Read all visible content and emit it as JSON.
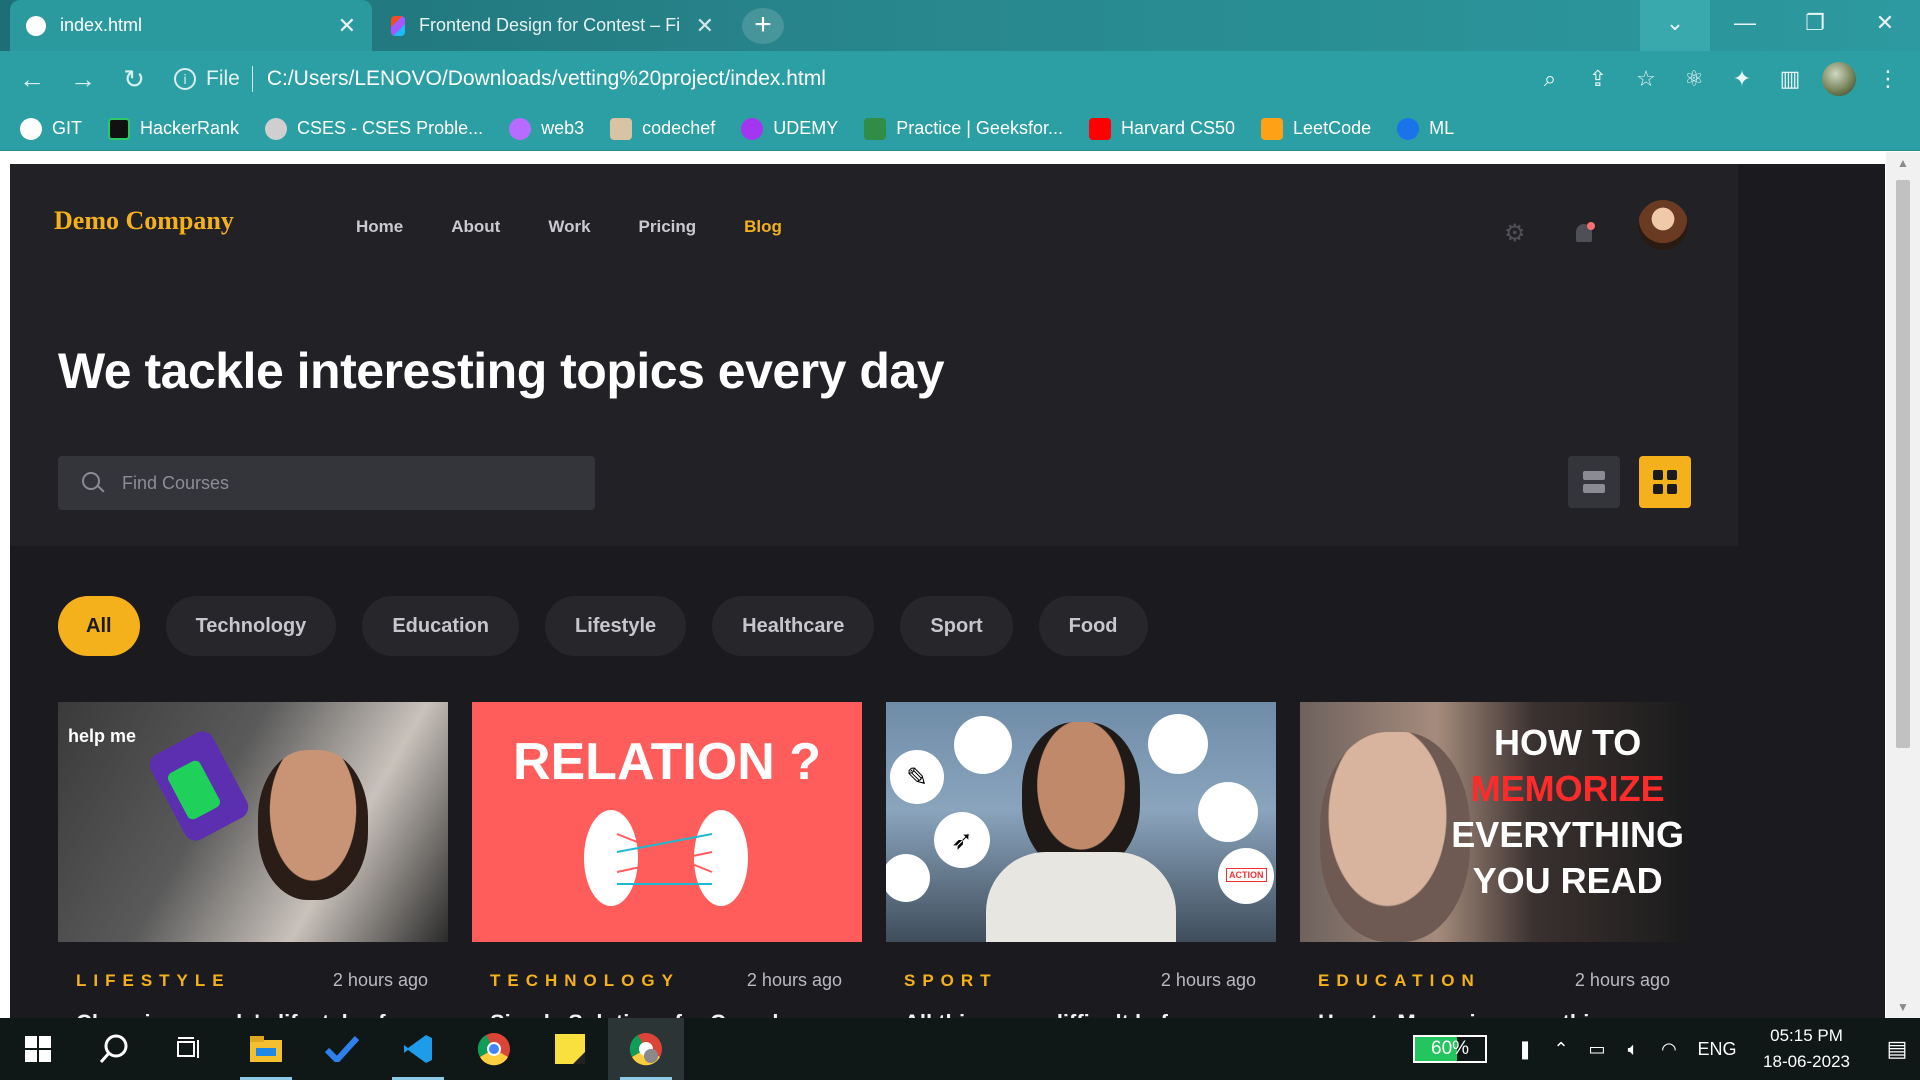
{
  "browser": {
    "tabs": [
      {
        "title": "index.html",
        "close": "✕"
      },
      {
        "title": "Frontend Design for Contest – Fi",
        "close": "✕"
      }
    ],
    "new_tab": "+",
    "window_controls": {
      "minimize": "—",
      "restore": "❐",
      "close": "✕",
      "dropdown": "⌄"
    },
    "nav": {
      "back": "←",
      "forward": "→",
      "reload": "↻"
    },
    "address": {
      "scheme": "File",
      "url": "C:/Users/LENOVO/Downloads/vetting%20project/index.html"
    },
    "bookmarks": [
      {
        "label": "GIT",
        "color": "#ffffff"
      },
      {
        "label": "HackerRank",
        "color": "#111111"
      },
      {
        "label": "CSES - CSES Proble...",
        "color": "#cfcfcf"
      },
      {
        "label": "web3",
        "color": "#b86cff"
      },
      {
        "label": "codechef",
        "color": "#d9c3a5"
      },
      {
        "label": "UDEMY",
        "color": "#a435f0"
      },
      {
        "label": "Practice | Geeksfor...",
        "color": "#2f8d46"
      },
      {
        "label": "Harvard CS50",
        "color": "#ff0000"
      },
      {
        "label": "LeetCode",
        "color": "#ffa116"
      },
      {
        "label": "ML",
        "color": "#1a73e8"
      }
    ]
  },
  "site": {
    "brand": "Demo Company",
    "nav": [
      "Home",
      "About",
      "Work",
      "Pricing",
      "Blog"
    ],
    "active_nav": "Blog",
    "headline": "We tackle interesting topics every day",
    "search": {
      "placeholder": "Find Courses"
    },
    "chips": [
      "All",
      "Technology",
      "Education",
      "Lifestyle",
      "Healthcare",
      "Sport",
      "Food"
    ],
    "active_chip": "All",
    "cards": [
      {
        "category": "LIFESTYLE",
        "time": "2 hours ago",
        "title": "Changing people's lifestyles for",
        "thumb_text": "help me"
      },
      {
        "category": "TECHNOLOGY",
        "time": "2 hours ago",
        "title": "Simple Solutions for Complex",
        "thumb_text": "RELATION ?"
      },
      {
        "category": "SPORT",
        "time": "2 hours ago",
        "title": "All things are difficult before",
        "thumb_text": "ACTION"
      },
      {
        "category": "EDUCATION",
        "time": "2 hours ago",
        "title": "How to Memorize everything",
        "thumb_lines": [
          "HOW TO",
          "MEMORIZE",
          "EVERYTHING",
          "YOU READ"
        ]
      }
    ],
    "accent": "#f5b11c",
    "background": "#1b1b1f"
  },
  "taskbar": {
    "battery": "60%",
    "language": "ENG",
    "time": "05:15 PM",
    "date": "18-06-2023"
  }
}
